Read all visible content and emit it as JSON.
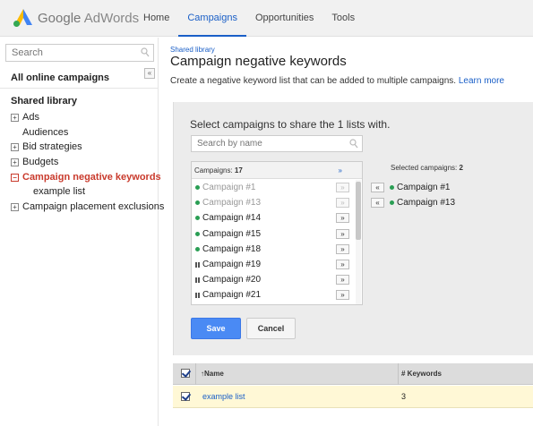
{
  "app": {
    "brand_google": "Google",
    "brand_product": "AdWords"
  },
  "nav": {
    "tabs": [
      {
        "label": "Home"
      },
      {
        "label": "Campaigns"
      },
      {
        "label": "Opportunities"
      },
      {
        "label": "Tools"
      }
    ],
    "active": "Campaigns"
  },
  "sidebar": {
    "search_placeholder": "Search",
    "collapse_label": "«",
    "all_campaigns": "All online campaigns",
    "shared_library": "Shared library",
    "items": [
      {
        "label": "Ads",
        "expandable": true,
        "box": "+"
      },
      {
        "label": "Audiences",
        "expandable": false,
        "box": ""
      },
      {
        "label": "Bid strategies",
        "expandable": true,
        "box": "+"
      },
      {
        "label": "Budgets",
        "expandable": true,
        "box": "+"
      },
      {
        "label": "Campaign negative keywords",
        "expandable": true,
        "box": "−",
        "active": true
      },
      {
        "label": "example list",
        "expandable": false,
        "box": "",
        "child": true
      },
      {
        "label": "Campaign placement exclusions",
        "expandable": true,
        "box": "+"
      }
    ]
  },
  "main": {
    "breadcrumb": "Shared library",
    "title": "Campaign negative keywords",
    "description": "Create a negative keyword list that can be added to multiple campaigns.",
    "learn_more": "Learn more"
  },
  "share_panel": {
    "title": "Select campaigns to share the 1 lists with.",
    "search_placeholder": "Search by name",
    "campaigns_label": "Campaigns:",
    "campaigns_count": "17",
    "add_all": "»",
    "campaigns": [
      {
        "name": "Campaign #1",
        "status": "removed",
        "button": "»"
      },
      {
        "name": "Campaign #13",
        "status": "removed",
        "button": "»"
      },
      {
        "name": "Campaign #14",
        "status": "active",
        "button": "»"
      },
      {
        "name": "Campaign #15",
        "status": "active",
        "button": "»"
      },
      {
        "name": "Campaign #18",
        "status": "active",
        "button": "»"
      },
      {
        "name": "Campaign #19",
        "status": "paused",
        "button": "»"
      },
      {
        "name": "Campaign #20",
        "status": "paused",
        "button": "»"
      },
      {
        "name": "Campaign #21",
        "status": "paused",
        "button": "»"
      }
    ],
    "selected_label": "Selected campaigns:",
    "selected_count": "2",
    "selected": [
      {
        "name": "Campaign #1",
        "button": "«"
      },
      {
        "name": "Campaign #13",
        "button": "«"
      }
    ],
    "save_label": "Save",
    "cancel_label": "Cancel"
  },
  "table": {
    "col_name": "↑Name",
    "col_keywords": "# Keywords",
    "rows": [
      {
        "name": "example list",
        "keywords": "3",
        "checked": true
      }
    ]
  },
  "colors": {
    "accent": "#1a5fc7",
    "active_sidebar": "#c93a2c",
    "status_green": "#2a9e54",
    "save_blue": "#4a8af4",
    "row_highlight": "#fff8d6"
  }
}
